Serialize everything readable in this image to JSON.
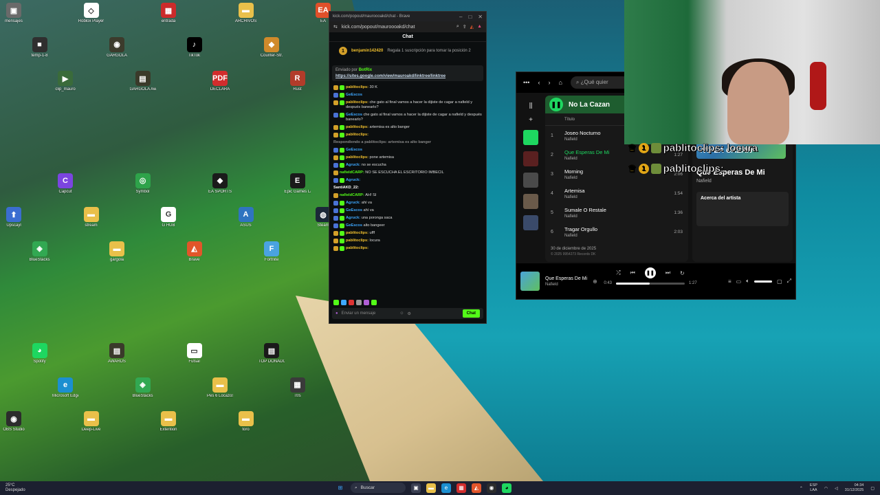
{
  "desktop_icons": [
    {
      "label": "mensajes",
      "color": "#6a6a6a",
      "glyph": "▣"
    },
    {
      "label": "temp-1-8",
      "color": "#2f2f2f",
      "glyph": "■"
    },
    {
      "label": "clip_mauro",
      "color": "#3a6b3a",
      "glyph": "▶"
    },
    {
      "label": "Roblox Player",
      "color": "#ffffff",
      "glyph": "◇"
    },
    {
      "label": "GARGOLA",
      "color": "#3c3b2c",
      "glyph": "◉"
    },
    {
      "label": "GARGOLA Awards",
      "color": "#3a3a2a",
      "glyph": "▤"
    },
    {
      "label": "entrada",
      "color": "#cc2b2b",
      "glyph": "▦"
    },
    {
      "label": "TikTok",
      "color": "#000000",
      "glyph": "♪"
    },
    {
      "label": "DECLARA",
      "color": "#d22d2d",
      "glyph": "PDF"
    },
    {
      "label": "ARCHIVOS",
      "color": "#e9c04a",
      "glyph": "▬"
    },
    {
      "label": "Counter-Str.",
      "color": "#d08a2b",
      "glyph": "◆"
    },
    {
      "label": "Rust",
      "color": "#b23c2a",
      "glyph": "R"
    },
    {
      "label": "EA",
      "color": "#e0502a",
      "glyph": "EA"
    },
    {
      "label": "Upscayl",
      "color": "#3b6dd1",
      "glyph": "⬆"
    },
    {
      "label": "BlueStacks",
      "color": "#32a852",
      "glyph": "◈"
    },
    {
      "label": "Capcut",
      "color": "#7b45e0",
      "glyph": "C"
    },
    {
      "label": "stream",
      "color": "#e9c04a",
      "glyph": "▬"
    },
    {
      "label": "gargola",
      "color": "#e9c04a",
      "glyph": "▬"
    },
    {
      "label": "Symbol",
      "color": "#2ea34a",
      "glyph": "◎"
    },
    {
      "label": "G HUB",
      "color": "#ffffff",
      "glyph": "G"
    },
    {
      "label": "Brave",
      "color": "#e2552a",
      "glyph": "◭"
    },
    {
      "label": "EA SPORTS",
      "color": "#1b1b1b",
      "glyph": "◆"
    },
    {
      "label": "ASUS",
      "color": "#2f74c0",
      "glyph": "A"
    },
    {
      "label": "Fortnite",
      "color": "#4aa3e0",
      "glyph": "F"
    },
    {
      "label": "Epic Games Launcher",
      "color": "#1a1a1a",
      "glyph": "E"
    },
    {
      "label": "Steam",
      "color": "#1b2838",
      "glyph": "◍"
    },
    {
      "label": "OBS Studio",
      "color": "#2c2c2c",
      "glyph": "◉"
    },
    {
      "label": "Spotify",
      "color": "#1ed760",
      "glyph": "◕"
    },
    {
      "label": "Microsoft Edge",
      "color": "#1b8fd0",
      "glyph": "e"
    },
    {
      "label": "Deep-Live",
      "color": "#e9c04a",
      "glyph": "▬"
    },
    {
      "label": "AWARDS",
      "color": "#3a3a2a",
      "glyph": "▤"
    },
    {
      "label": "BlueStacks",
      "color": "#32a852",
      "glyph": "◈"
    },
    {
      "label": "Extention",
      "color": "#e9c04a",
      "glyph": "▬"
    },
    {
      "label": "Futsal",
      "color": "#ffffff",
      "glyph": "▭"
    },
    {
      "label": "Pes 6 Locazos",
      "color": "#e9c04a",
      "glyph": "▬"
    },
    {
      "label": "toro",
      "color": "#e9c04a",
      "glyph": "▬"
    },
    {
      "label": "TOP DONADORES GARGOLA AWARDS",
      "color": "#1a1a1a",
      "glyph": "▤"
    },
    {
      "label": "Ttrs",
      "color": "#3a3a3a",
      "glyph": "▦"
    }
  ],
  "browser": {
    "tab_title": "kick.com/popout/mauroooakd/chat - Brave",
    "url": "kick.com/popout/mauroooakd/chat",
    "chat_header": "Chat",
    "sub_user": "benjamin142420",
    "sub_text": "Regala 1 suscripción para tomar la posición 2",
    "pinned_by": "Enviado por",
    "pinned_bot": "BotRix",
    "pinned_link": "https://sites.google.com/view/mauroakd/linktree/linktree",
    "messages": [
      {
        "user": "pablitoclips:",
        "color": "#f2c12e",
        "text": "30 K",
        "badges": [
          "a",
          "b"
        ]
      },
      {
        "user": "GeEscos",
        "color": "#3ea8ff",
        "text": "",
        "badges": [
          "c",
          "b"
        ]
      },
      {
        "user": "pablitoclips:",
        "color": "#f2c12e",
        "text": "che gato al final vamos a hacer la dijiste de cagar a nafield y después banearlo?",
        "badges": [
          "a",
          "b"
        ]
      },
      {
        "user": "GeEscos",
        "color": "#3ea8ff",
        "text": "che gato al final vamos a hacer la dijiste de cagar a nafield y después banearlo?",
        "badges": [
          "c",
          "b"
        ]
      },
      {
        "user": "pablitoclips:",
        "color": "#f2c12e",
        "text": "artemisa es alto banger",
        "badges": [
          "a",
          "b"
        ]
      },
      {
        "user": "pablitoclips:",
        "color": "#f2c12e",
        "text": "",
        "badges": [
          "a",
          "b"
        ]
      },
      {
        "user": "Respondiendo a pablitoclips: artemisa es alto banger",
        "color": "#888888",
        "text": "",
        "badges": []
      },
      {
        "user": "GeEscos",
        "color": "#3ea8ff",
        "text": "",
        "badges": [
          "c",
          "b"
        ]
      },
      {
        "user": "pablitoclips:",
        "color": "#f2c12e",
        "text": "pone artemisa",
        "badges": [
          "a",
          "b"
        ]
      },
      {
        "user": "Agruck:",
        "color": "#3ea8ff",
        "text": "no se escucha",
        "badges": [
          "c",
          "b"
        ]
      },
      {
        "user": "nafieldCARP:",
        "color": "#53fc18",
        "text": "NO SE ESCUCHA EL ESCRITORIO IMBECIL",
        "badges": [
          "a"
        ]
      },
      {
        "user": "Agruck:",
        "color": "#3ea8ff",
        "text": "",
        "badges": [
          "c",
          "b"
        ]
      },
      {
        "user": "SantiAKD_22:",
        "color": "#ffffff",
        "text": "",
        "badges": []
      },
      {
        "user": "nafieldCARP:",
        "color": "#53fc18",
        "text": "AH! SI",
        "badges": [
          "a"
        ]
      },
      {
        "user": "Agruck:",
        "color": "#3ea8ff",
        "text": "ahí va",
        "badges": [
          "c",
          "b"
        ]
      },
      {
        "user": "GeEscos",
        "color": "#3ea8ff",
        "text": "ahí va",
        "badges": [
          "c",
          "b"
        ]
      },
      {
        "user": "Agruck:",
        "color": "#3ea8ff",
        "text": "una poronga saca",
        "badges": [
          "c",
          "b"
        ]
      },
      {
        "user": "GeEscos",
        "color": "#3ea8ff",
        "text": "alto bangeer",
        "badges": [
          "c",
          "b"
        ]
      },
      {
        "user": "pablitoclips:",
        "color": "#f2c12e",
        "text": "ufff",
        "badges": [
          "a",
          "b"
        ]
      },
      {
        "user": "pablitoclips:",
        "color": "#f2c12e",
        "text": "locura",
        "badges": [
          "a",
          "b"
        ]
      },
      {
        "user": "pablitoclips:",
        "color": "#f2c12e",
        "text": "",
        "badges": [
          "a",
          "b"
        ]
      }
    ],
    "input_placeholder": "Enviar un mensaje",
    "chat_button": "Chat"
  },
  "spotify": {
    "search_placeholder": "¿Qué quier",
    "playlist_title": "No La Cazan",
    "col_title": "Título",
    "tracks": [
      {
        "n": "1",
        "title": "Joseo Nocturno",
        "artist": "Nafield",
        "duration": "",
        "active": false
      },
      {
        "n": "2",
        "title": "Que Esperas De Mi",
        "artist": "Nafield",
        "duration": "1:27",
        "active": true
      },
      {
        "n": "3",
        "title": "Morning",
        "artist": "Nafield",
        "duration": "2:06",
        "active": false
      },
      {
        "n": "4",
        "title": "Artemisa",
        "artist": "Nafield",
        "duration": "1:54",
        "active": false
      },
      {
        "n": "5",
        "title": "Sumale O Restale",
        "artist": "Nafield",
        "duration": "1:36",
        "active": false
      },
      {
        "n": "6",
        "title": "Tragar Orgullo",
        "artist": "Nafield",
        "duration": "2:03",
        "active": false
      }
    ],
    "release_date": "30 de diciembre de 2025",
    "release_rights": "© 2025 9954273 Records DK",
    "cover_text": "NO LA CAZAN",
    "now_playing_title": "Que Esperas De Mi",
    "now_playing_artist": "Nafield",
    "about_label": "Acerca del artista",
    "bar_title": "Que Esperas De Mi",
    "bar_artist": "Nafield",
    "elapsed": "0:43",
    "total": "1:27",
    "progress_fraction": 0.49
  },
  "alerts": [
    {
      "count": "1",
      "text": "pablitoclips: locura"
    },
    {
      "count": "1",
      "text": "pablitoclips:"
    }
  ],
  "taskbar": {
    "temp": "25°C",
    "weather": "Despejado",
    "search": "Buscar",
    "lang1": "ESP",
    "lang2": "LAA",
    "time": "04:34",
    "date": "31/12/2025"
  }
}
